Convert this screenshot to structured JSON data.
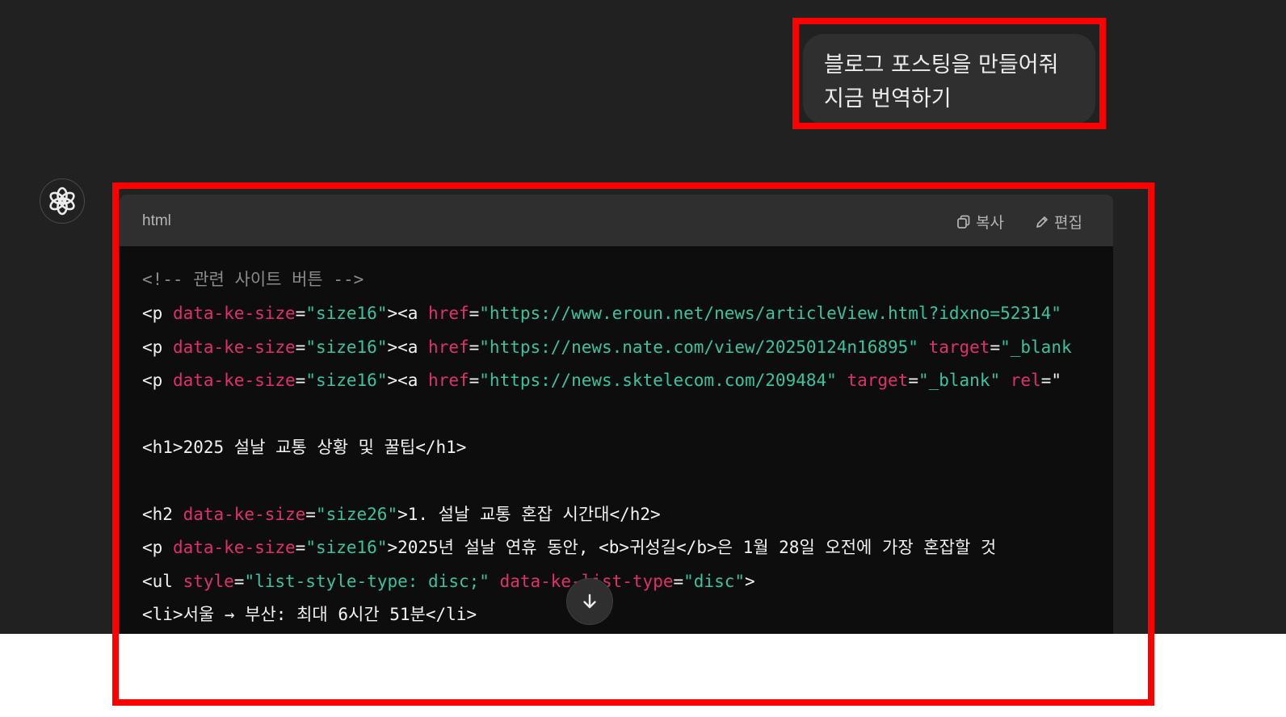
{
  "user_message": {
    "lines": [
      "블로그 포스팅을 만들어줘",
      "지금 번역하기"
    ]
  },
  "assistant": {
    "avatar_icon": "openai-logo-icon"
  },
  "code_block": {
    "language": "html",
    "copy_label": "복사",
    "edit_label": "편집",
    "lines": [
      [
        {
          "t": "c",
          "v": "<!-- 관련 사이트 버튼 -->"
        }
      ],
      [
        {
          "t": "p",
          "v": "<p "
        },
        {
          "t": "a",
          "v": "data-ke-size"
        },
        {
          "t": "p",
          "v": "="
        },
        {
          "t": "s",
          "v": "\"size16\""
        },
        {
          "t": "p",
          "v": "><a "
        },
        {
          "t": "a",
          "v": "href"
        },
        {
          "t": "p",
          "v": "="
        },
        {
          "t": "s",
          "v": "\"https://www.eroun.net/news/articleView.html?idxno=52314\""
        }
      ],
      [
        {
          "t": "p",
          "v": "<p "
        },
        {
          "t": "a",
          "v": "data-ke-size"
        },
        {
          "t": "p",
          "v": "="
        },
        {
          "t": "s",
          "v": "\"size16\""
        },
        {
          "t": "p",
          "v": "><a "
        },
        {
          "t": "a",
          "v": "href"
        },
        {
          "t": "p",
          "v": "="
        },
        {
          "t": "s",
          "v": "\"https://news.nate.com/view/20250124n16895\""
        },
        {
          "t": "p",
          "v": " "
        },
        {
          "t": "a",
          "v": "target"
        },
        {
          "t": "p",
          "v": "="
        },
        {
          "t": "s",
          "v": "\"_blank"
        }
      ],
      [
        {
          "t": "p",
          "v": "<p "
        },
        {
          "t": "a",
          "v": "data-ke-size"
        },
        {
          "t": "p",
          "v": "="
        },
        {
          "t": "s",
          "v": "\"size16\""
        },
        {
          "t": "p",
          "v": "><a "
        },
        {
          "t": "a",
          "v": "href"
        },
        {
          "t": "p",
          "v": "="
        },
        {
          "t": "s",
          "v": "\"https://news.sktelecom.com/209484\""
        },
        {
          "t": "p",
          "v": " "
        },
        {
          "t": "a",
          "v": "target"
        },
        {
          "t": "p",
          "v": "="
        },
        {
          "t": "s",
          "v": "\"_blank\""
        },
        {
          "t": "p",
          "v": " "
        },
        {
          "t": "a",
          "v": "rel"
        },
        {
          "t": "p",
          "v": "=\""
        }
      ],
      [],
      [
        {
          "t": "p",
          "v": "<h1>2025 설날 교통 상황 및 꿀팁</h1>"
        }
      ],
      [],
      [
        {
          "t": "p",
          "v": "<h2 "
        },
        {
          "t": "a",
          "v": "data-ke-size"
        },
        {
          "t": "p",
          "v": "="
        },
        {
          "t": "s",
          "v": "\"size26\""
        },
        {
          "t": "p",
          "v": ">1. 설날 교통 혼잡 시간대</h2>"
        }
      ],
      [
        {
          "t": "p",
          "v": "<p "
        },
        {
          "t": "a",
          "v": "data-ke-size"
        },
        {
          "t": "p",
          "v": "="
        },
        {
          "t": "s",
          "v": "\"size16\""
        },
        {
          "t": "p",
          "v": ">2025년 설날 연휴 동안, <b>귀성길</b>은 1월 28일 오전에 가장 혼잡할 것"
        }
      ],
      [
        {
          "t": "p",
          "v": "<ul "
        },
        {
          "t": "a",
          "v": "style"
        },
        {
          "t": "p",
          "v": "="
        },
        {
          "t": "s",
          "v": "\"list-style-type: disc;\""
        },
        {
          "t": "p",
          "v": " "
        },
        {
          "t": "a",
          "v": "data-ke-list-type"
        },
        {
          "t": "p",
          "v": "="
        },
        {
          "t": "s",
          "v": "\"disc\""
        },
        {
          "t": "p",
          "v": ">"
        }
      ],
      [
        {
          "t": "p",
          "v": "<li>서울 → 부산: 최대 6시간 51분</li>"
        }
      ]
    ]
  },
  "scroll_button": {
    "icon": "arrow-down-icon"
  },
  "highlight_color": "#ff0000"
}
